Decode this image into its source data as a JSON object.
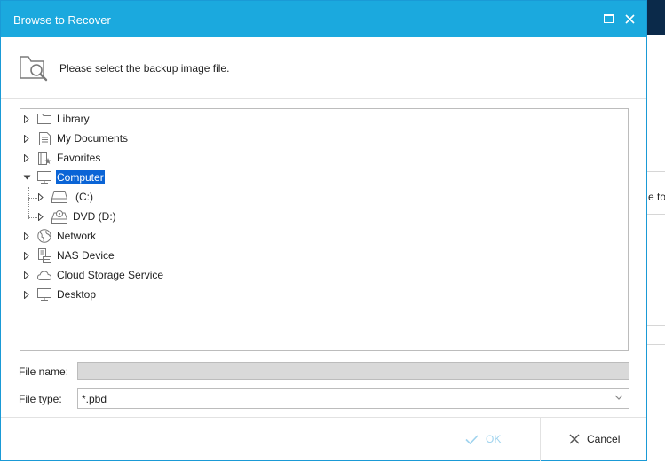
{
  "background": {
    "partial_text_top": "",
    "partial_text_right": "e to"
  },
  "dialog": {
    "title": "Browse to Recover",
    "header_text": "Please select the backup image file.",
    "tree": [
      {
        "label": "Library",
        "icon": "folder-icon",
        "expanded": false,
        "level": 0
      },
      {
        "label": "My Documents",
        "icon": "document-icon",
        "expanded": false,
        "level": 0
      },
      {
        "label": "Favorites",
        "icon": "favorites-icon",
        "expanded": false,
        "level": 0
      },
      {
        "label": "Computer",
        "icon": "monitor-icon",
        "expanded": true,
        "selected": true,
        "level": 0
      },
      {
        "label": "(C:)",
        "icon": "drive-icon",
        "expanded": false,
        "level": 1
      },
      {
        "label": "DVD (D:)",
        "icon": "dvd-drive-icon",
        "expanded": false,
        "level": 1
      },
      {
        "label": "Network",
        "icon": "globe-icon",
        "expanded": false,
        "level": 0
      },
      {
        "label": "NAS Device",
        "icon": "nas-icon",
        "expanded": false,
        "level": 0
      },
      {
        "label": "Cloud Storage Service",
        "icon": "cloud-icon",
        "expanded": false,
        "level": 0
      },
      {
        "label": "Desktop",
        "icon": "monitor-icon",
        "expanded": false,
        "level": 0
      }
    ],
    "file_name_label": "File name:",
    "file_name_value": "",
    "file_type_label": "File type:",
    "file_type_value": "*.pbd",
    "ok_label": "OK",
    "cancel_label": "Cancel",
    "colors": {
      "titlebar": "#1ba9de",
      "selection": "#0a64d6",
      "ok_disabled": "#9fd3ee"
    }
  }
}
